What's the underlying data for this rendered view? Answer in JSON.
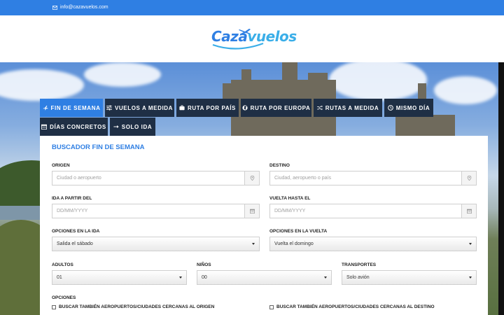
{
  "topbar": {
    "email": "info@cazavuelos.com",
    "icon": "envelope-icon"
  },
  "brand": {
    "logo_part1": "Caza",
    "logo_part2": "vuelos"
  },
  "tabs": [
    {
      "label": "FIN DE SEMANA",
      "icon": "plane-icon",
      "active": true
    },
    {
      "label": "VUELOS A MEDIDA",
      "icon": "sliders-icon"
    },
    {
      "label": "RUTA POR PAÍS",
      "icon": "suitcase-icon"
    },
    {
      "label": "RUTA POR EUROPA",
      "icon": "globe-icon"
    },
    {
      "label": "RUTAS A MEDIDA",
      "icon": "shuffle-icon"
    },
    {
      "label": "MISMO DÍA",
      "icon": "clock-icon"
    },
    {
      "label": "DÍAS CONCRETOS",
      "icon": "calendar-icon"
    },
    {
      "label": "SOLO IDA",
      "icon": "arrow-right-icon"
    }
  ],
  "search": {
    "title": "BUSCADOR FIN DE SEMANA",
    "origin_label": "ORIGEN",
    "origin_placeholder": "Ciudad o aeropuerto",
    "destination_label": "DESTINO",
    "destination_placeholder": "Ciudad, aeropuerto o país",
    "depart_label": "IDA A PARTIR DEL",
    "depart_placeholder": "DD/MM/YYYY",
    "return_label": "VUELTA HASTA EL",
    "return_placeholder": "DD/MM/YYYY",
    "outbound_options_label": "OPCIONES EN LA IDA",
    "outbound_options_value": "Salida el sábado",
    "return_options_label": "OPCIONES EN LA VUELTA",
    "return_options_value": "Vuelta el domingo",
    "adults_label": "ADULTOS",
    "adults_value": "01",
    "children_label": "NIÑOS",
    "children_value": "00",
    "transport_label": "TRANSPORTES",
    "transport_value": "Solo avión",
    "options_label": "OPCIONES",
    "nearby_origin": "BUSCAR TAMBIÉN AEROPUERTOS/CIUDADES CERCANAS AL ORIGEN",
    "nearby_destination": "BUSCAR TAMBIÉN AEROPUERTOS/CIUDADES CERCANAS AL DESTINO"
  },
  "colors": {
    "accent": "#2f7fe3",
    "tab_dark": "#1f2f45"
  }
}
